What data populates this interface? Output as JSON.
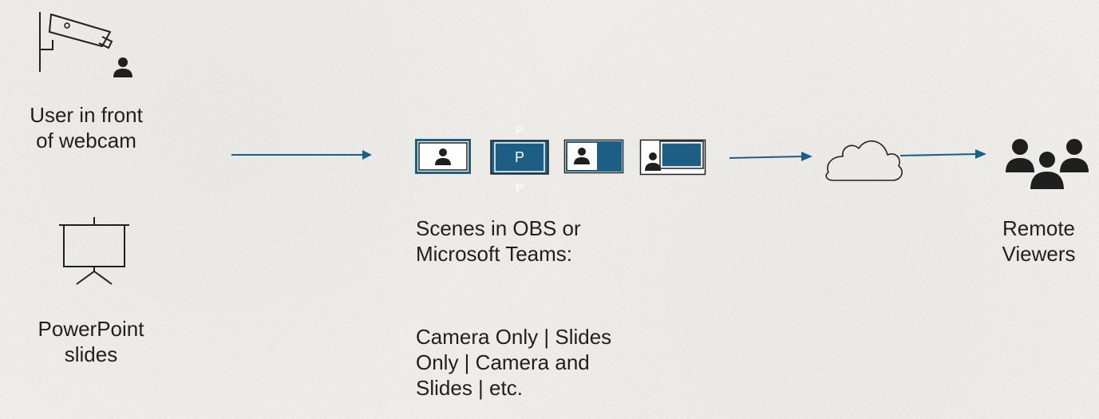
{
  "webcam_label": [
    "User in front",
    "of webcam"
  ],
  "slides_label": [
    "PowerPoint",
    "slides"
  ],
  "scenes_heading": [
    "Scenes in OBS or",
    "Microsoft Teams:"
  ],
  "scenes_list": [
    "Camera Only | Slides",
    "Only | Camera and",
    "Slides | etc."
  ],
  "viewers_label": [
    "Remote",
    "Viewers"
  ],
  "slide_letter": "P",
  "colors": {
    "accent": "#1d5f84",
    "dark": "#1f1f1f"
  },
  "icons": [
    "security-camera-icon",
    "user-icon",
    "projector-screen-icon",
    "scene-camera-only-icon",
    "scene-slides-only-icon",
    "scene-camera-and-slides-icon",
    "scene-picture-in-picture-icon",
    "cloud-icon",
    "group-icon"
  ]
}
